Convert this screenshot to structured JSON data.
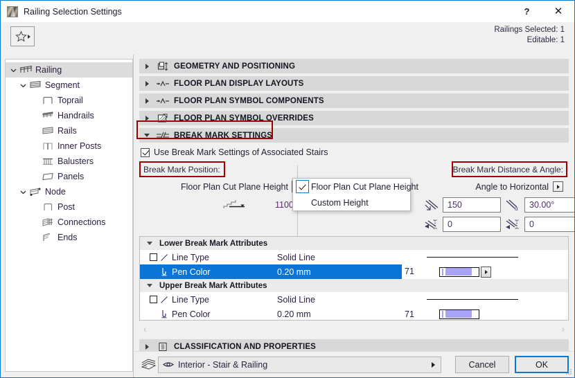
{
  "window": {
    "title": "Railing Selection Settings",
    "icon": "railing-app-icon",
    "help_label": "?",
    "close_label": "✕"
  },
  "toolbar": {
    "favorites_icon": "star-icon",
    "favorites_dropdown_icon": "triangle-right-icon",
    "selection_line1": "Railings Selected: 1",
    "selection_line2": "Editable: 1"
  },
  "sidebar": {
    "items": [
      {
        "label": "Railing",
        "icon": "railing-icon",
        "level": 0,
        "twisty": "down",
        "selected": true
      },
      {
        "label": "Segment",
        "icon": "segment-icon",
        "level": 1,
        "twisty": "down",
        "selected": false
      },
      {
        "label": "Toprail",
        "icon": "toprail-icon",
        "level": 2,
        "twisty": "none",
        "selected": false
      },
      {
        "label": "Handrails",
        "icon": "handrails-icon",
        "level": 2,
        "twisty": "none",
        "selected": false
      },
      {
        "label": "Rails",
        "icon": "rails-icon",
        "level": 2,
        "twisty": "none",
        "selected": false
      },
      {
        "label": "Inner Posts",
        "icon": "inner-posts-icon",
        "level": 2,
        "twisty": "none",
        "selected": false
      },
      {
        "label": "Balusters",
        "icon": "balusters-icon",
        "level": 2,
        "twisty": "none",
        "selected": false
      },
      {
        "label": "Panels",
        "icon": "panels-icon",
        "level": 2,
        "twisty": "none",
        "selected": false
      },
      {
        "label": "Node",
        "icon": "node-icon",
        "level": 1,
        "twisty": "down",
        "selected": false
      },
      {
        "label": "Post",
        "icon": "post-icon",
        "level": 2,
        "twisty": "none",
        "selected": false
      },
      {
        "label": "Connections",
        "icon": "connections-icon",
        "level": 2,
        "twisty": "none",
        "selected": false
      },
      {
        "label": "Ends",
        "icon": "ends-icon",
        "level": 2,
        "twisty": "none",
        "selected": false
      }
    ]
  },
  "panels": [
    {
      "label": "GEOMETRY AND POSITIONING",
      "icon": "geometry-icon",
      "expanded": false
    },
    {
      "label": "FLOOR PLAN DISPLAY LAYOUTS",
      "icon": "display-layouts-icon",
      "expanded": false
    },
    {
      "label": "FLOOR PLAN SYMBOL COMPONENTS",
      "icon": "symbol-components-icon",
      "expanded": false
    },
    {
      "label": "FLOOR PLAN SYMBOL OVERRIDES",
      "icon": "symbol-overrides-icon",
      "expanded": false
    },
    {
      "label": "BREAK MARK SETTINGS",
      "icon": "break-mark-icon",
      "expanded": true
    }
  ],
  "break_mark": {
    "use_associated_stairs_label": "Use Break Mark Settings of Associated Stairs",
    "use_associated_stairs_checked": true,
    "position_group_label": "Break Mark Position:",
    "distance_group_label": "Break Mark Distance & Angle:",
    "cut_plane_mode_label": "Floor Plan Cut Plane Height",
    "cut_plane_height_value": "1100",
    "cut_plane_icon": "stair-cut-plane-icon",
    "angle_mode_label": "Angle to Horizontal",
    "dropdown": {
      "open": true,
      "items": [
        {
          "label": "Floor Plan Cut Plane Height",
          "checked": true
        },
        {
          "label": "Custom Height",
          "checked": false
        }
      ]
    },
    "fields": [
      {
        "name": "break-mark-distance",
        "icon": "break-distance-icon",
        "value": "150"
      },
      {
        "name": "break-mark-angle",
        "icon": "break-angle-icon",
        "value": "30.00°"
      },
      {
        "name": "break-mark-offset-1",
        "icon": "break-offset-1-icon",
        "value": "0"
      },
      {
        "name": "break-mark-offset-2",
        "icon": "break-offset-2-icon",
        "value": "0"
      }
    ]
  },
  "attributes": {
    "groups": [
      {
        "title": "Lower Break Mark Attributes",
        "expanded": true,
        "rows": [
          {
            "name": "Line Type",
            "value": "Solid Line",
            "pen": "",
            "has_checkbox": true,
            "icon": "line-type-icon",
            "preview": "line",
            "selected": false,
            "swatch": false
          },
          {
            "name": "Pen Color",
            "value": "0.20 mm",
            "pen": "71",
            "has_checkbox": false,
            "icon": "pen-icon",
            "preview": "swatch",
            "selected": true,
            "swatch": true,
            "swatch_color": "#a8a3f2",
            "swatch_has_arrow": true
          }
        ]
      },
      {
        "title": "Upper Break Mark Attributes",
        "expanded": true,
        "rows": [
          {
            "name": "Line Type",
            "value": "Solid Line",
            "pen": "",
            "has_checkbox": true,
            "icon": "line-type-icon",
            "preview": "line",
            "selected": false,
            "swatch": false
          },
          {
            "name": "Pen Color",
            "value": "0.20 mm",
            "pen": "71",
            "has_checkbox": false,
            "icon": "pen-icon",
            "preview": "swatch",
            "selected": false,
            "swatch": true,
            "swatch_color": "#a8a3f2",
            "swatch_has_arrow": false
          }
        ]
      }
    ],
    "scroll_left_icon": "chevron-left-icon",
    "scroll_right_icon": "chevron-right-icon"
  },
  "classification_panel": {
    "label": "CLASSIFICATION AND PROPERTIES",
    "icon": "classification-icon",
    "expanded": false
  },
  "footer": {
    "layer_icon": "layers-icon",
    "layer_visibility_icon": "eye-icon",
    "layer_name": "Interior - Stair & Railing",
    "cancel_label": "Cancel",
    "ok_label": "OK"
  },
  "colors": {
    "accent": "#0a7ad1",
    "highlight_box": "#a10000",
    "selection_row": "#0a74d8",
    "pen_swatch": "#a8a3f2",
    "panel_header_bg": "#d8d8d8"
  }
}
